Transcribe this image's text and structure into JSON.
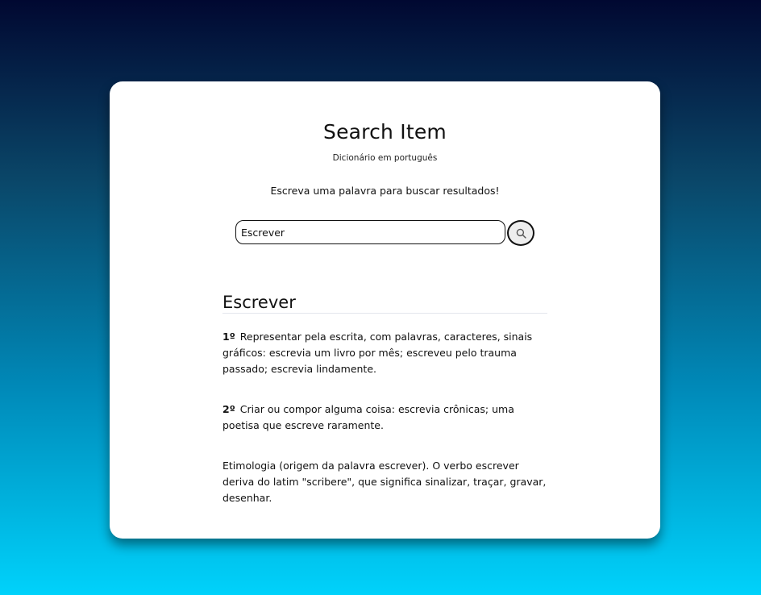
{
  "header": {
    "title": "Search Item",
    "subtitle": "Dicionário em português",
    "prompt": "Escreva uma palavra para buscar  resultados!"
  },
  "search": {
    "value": "Escrever",
    "button_icon": "search-icon"
  },
  "result": {
    "word": "Escrever",
    "definitions": [
      {
        "ordinal": "1º",
        "text": "Representar pela escrita, com palavras, caracteres, sinais gráficos: escrevia um livro por mês; escreveu pelo trauma passado; escrevia lindamente."
      },
      {
        "ordinal": "2º",
        "text": "Criar ou compor alguma coisa: escrevia crônicas; uma poetisa que escreve raramente."
      }
    ],
    "etymology": "Etimologia (origem da palavra escrever). O verbo escrever deriva do latim \"scribere\", que significa sinalizar, traçar, gravar, desenhar."
  },
  "colors": {
    "background_top": "#010831",
    "background_bottom": "#00d2fb",
    "card": "#ffffff",
    "text": "#111111"
  }
}
